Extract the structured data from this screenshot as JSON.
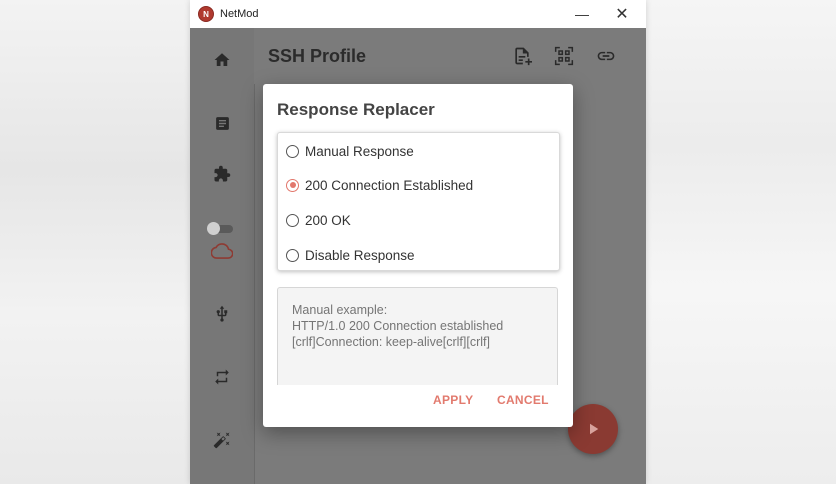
{
  "window": {
    "title": "NetMod",
    "logo_text": "N",
    "minimize_glyph": "—",
    "close_glyph": "✕"
  },
  "header": {
    "title": "SSH Profile"
  },
  "sidebar": {
    "items": [
      {
        "icon": "home-icon"
      },
      {
        "icon": "document-icon"
      },
      {
        "icon": "puzzle-icon"
      },
      {
        "icon": "cloud-icon",
        "active": true
      },
      {
        "icon": "usb-icon"
      },
      {
        "icon": "repeat-icon"
      },
      {
        "icon": "magic-wand-icon"
      }
    ],
    "toggle_on": false
  },
  "dialog": {
    "title": "Response Replacer",
    "options": [
      {
        "label": "Manual Response",
        "selected": false
      },
      {
        "label": "200 Connection Established",
        "selected": true
      },
      {
        "label": "200 OK",
        "selected": false
      },
      {
        "label": "Disable Response",
        "selected": false
      }
    ],
    "textarea_placeholder": "Manual example:\nHTTP/1.0 200 Connection established\n[crlf]Connection: keep-alive[crlf][crlf]",
    "apply_label": "APPLY",
    "cancel_label": "CANCEL"
  },
  "colors": {
    "accent": "#e27a6e",
    "fab": "#8a3a32",
    "overlay": "#7b7b7b"
  }
}
